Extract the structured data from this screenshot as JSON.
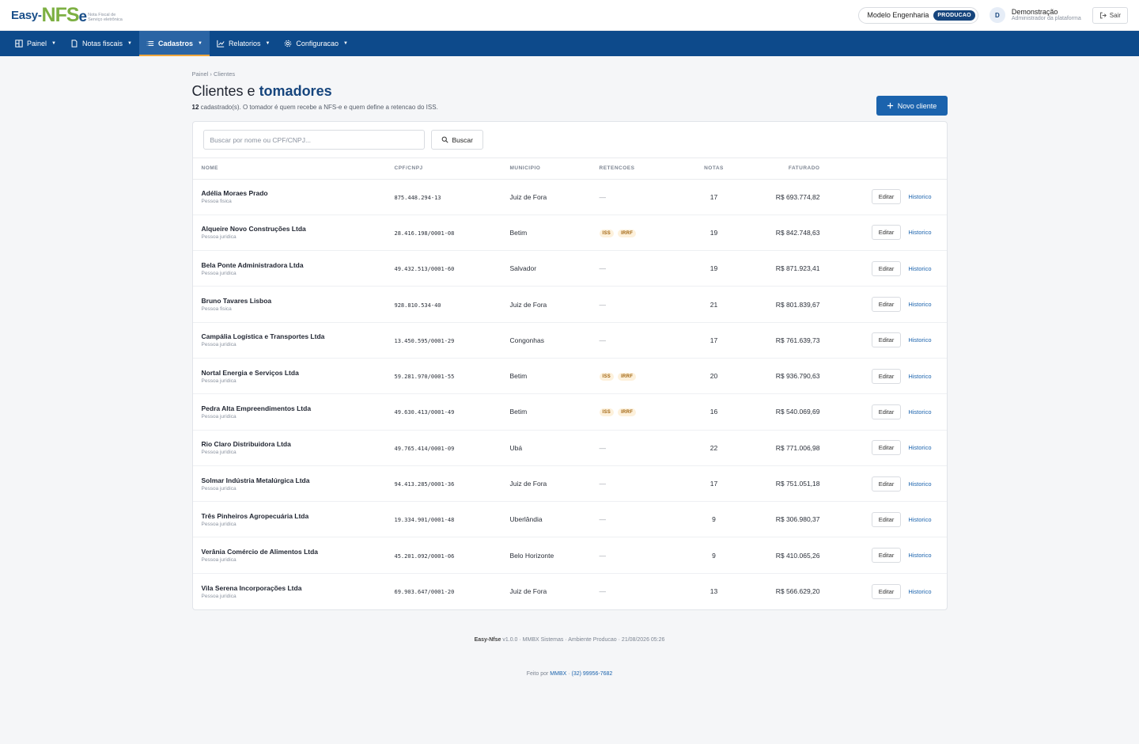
{
  "brand": {
    "easy": "Easy-",
    "nfs": "NFS",
    "e": "e",
    "sub_line1": "Nota Fiscal de",
    "sub_line2": "Serviço eletrônica"
  },
  "header": {
    "company": "Modelo Engenharia",
    "environment": "PRODUCAO",
    "user_initial": "D",
    "user_name": "Demonstração",
    "user_role": "Administrador da plataforma",
    "logout_label": "Sair"
  },
  "nav": {
    "painel": "Painel",
    "notas": "Notas fiscais",
    "cadastros": "Cadastros",
    "relatorios": "Relatorios",
    "config": "Configuracao"
  },
  "page": {
    "breadcrumb": "Painel › Clientes",
    "title_prefix": "Clientes e",
    "title_highlight": "tomadores",
    "count": "12",
    "subtitle": " cadastrado(s). O tomador é quem recebe a NFS-e e quem define a retencao do ISS.",
    "new_button": "Novo cliente"
  },
  "search": {
    "placeholder": "Buscar por nome ou CPF/CNPJ...",
    "button": "Buscar"
  },
  "table": {
    "headers": {
      "nome": "NOME",
      "doc": "CPF/CNPJ",
      "municipio": "MUNICIPIO",
      "retencoes": "RETENCOES",
      "notas": "NOTAS",
      "faturado": "FATURADO"
    },
    "edit_label": "Editar",
    "history_label": "Historico",
    "no_retention": "—",
    "rows": [
      {
        "name": "Adélia Moraes Prado",
        "type": "Pessoa fisica",
        "doc": "875.448.294-13",
        "city": "Juiz de Fora",
        "ret": [],
        "notas": "17",
        "fat": "R$ 693.774,82"
      },
      {
        "name": "Alqueire Novo Construções Ltda",
        "type": "Pessoa juridica",
        "doc": "28.416.198/0001-08",
        "city": "Betim",
        "ret": [
          "ISS",
          "IRRF"
        ],
        "notas": "19",
        "fat": "R$ 842.748,63"
      },
      {
        "name": "Bela Ponte Administradora Ltda",
        "type": "Pessoa juridica",
        "doc": "49.432.513/0001-60",
        "city": "Salvador",
        "ret": [],
        "notas": "19",
        "fat": "R$ 871.923,41"
      },
      {
        "name": "Bruno Tavares Lisboa",
        "type": "Pessoa fisica",
        "doc": "928.810.534-40",
        "city": "Juiz de Fora",
        "ret": [],
        "notas": "21",
        "fat": "R$ 801.839,67"
      },
      {
        "name": "Campália Logística e Transportes Ltda",
        "type": "Pessoa juridica",
        "doc": "13.450.595/0001-29",
        "city": "Congonhas",
        "ret": [],
        "notas": "17",
        "fat": "R$ 761.639,73"
      },
      {
        "name": "Nortal Energia e Serviços Ltda",
        "type": "Pessoa juridica",
        "doc": "59.281.970/0001-55",
        "city": "Betim",
        "ret": [
          "ISS",
          "IRRF"
        ],
        "notas": "20",
        "fat": "R$ 936.790,63"
      },
      {
        "name": "Pedra Alta Empreendimentos Ltda",
        "type": "Pessoa juridica",
        "doc": "49.630.413/0001-49",
        "city": "Betim",
        "ret": [
          "ISS",
          "IRRF"
        ],
        "notas": "16",
        "fat": "R$ 540.069,69"
      },
      {
        "name": "Rio Claro Distribuidora Ltda",
        "type": "Pessoa juridica",
        "doc": "49.765.414/0001-09",
        "city": "Ubá",
        "ret": [],
        "notas": "22",
        "fat": "R$ 771.006,98"
      },
      {
        "name": "Solmar Indústria Metalúrgica Ltda",
        "type": "Pessoa juridica",
        "doc": "94.413.285/0001-36",
        "city": "Juiz de Fora",
        "ret": [],
        "notas": "17",
        "fat": "R$ 751.051,18"
      },
      {
        "name": "Três Pinheiros Agropecuária Ltda",
        "type": "Pessoa juridica",
        "doc": "19.334.901/0001-48",
        "city": "Uberlândia",
        "ret": [],
        "notas": "9",
        "fat": "R$ 306.980,37"
      },
      {
        "name": "Verânia Comércio de Alimentos Ltda",
        "type": "Pessoa juridica",
        "doc": "45.201.092/0001-06",
        "city": "Belo Horizonte",
        "ret": [],
        "notas": "9",
        "fat": "R$ 410.065,26"
      },
      {
        "name": "Vila Serena Incorporações Ltda",
        "type": "Pessoa juridica",
        "doc": "69.903.647/0001-20",
        "city": "Juiz de Fora",
        "ret": [],
        "notas": "13",
        "fat": "R$ 566.629,20"
      }
    ]
  },
  "footer": {
    "app": "Easy-Nfse",
    "info": " v1.0.0 · MMBX Sistemas · Ambiente Producao · 21/08/2026 05:26",
    "made_by": "Feito por ",
    "company": "MMBX",
    "sep": " · ",
    "phone": "(32) 99956-7682"
  },
  "colors": {
    "nav": "#0d4a8b",
    "primary": "#1b63ad",
    "accent": "#f0a63c",
    "retention_tag_bg": "#fdf1dc",
    "retention_tag_text": "#a0620c"
  }
}
